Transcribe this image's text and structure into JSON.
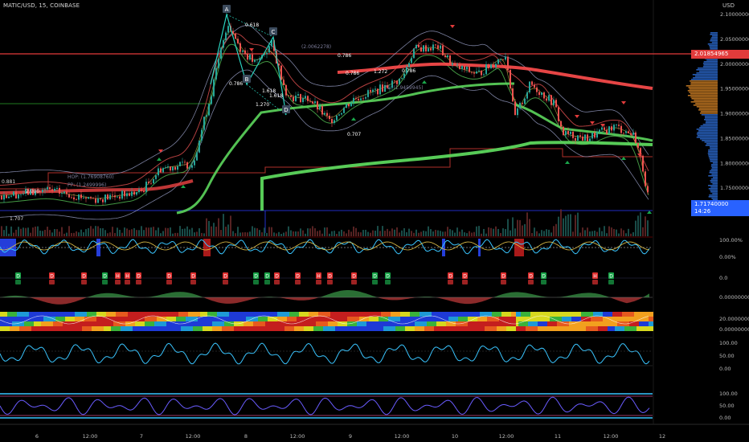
{
  "header": {
    "symbol": "MATIC/USD, 15, COINBASE",
    "currency": "USD"
  },
  "tags": {
    "hline_price": "2.01854965",
    "last_price": "1.71740000",
    "countdown": "14:26",
    "osc_pct": "100.00%"
  },
  "price_axis": [
    "2.10000000",
    "2.05000000",
    "2.00000000",
    "1.95000000",
    "1.90000000",
    "1.85000000",
    "1.80000000",
    "1.75000000",
    "1.70000000"
  ],
  "pane_axes": {
    "p2": [
      "100.00%",
      "0.00%"
    ],
    "p3": [
      "0.0"
    ],
    "p4": [
      "0.00000000"
    ],
    "p5": [
      "20.00000000",
      "0.00000000"
    ],
    "p6": [
      "100.00",
      "50.00",
      "0.00"
    ],
    "p7": [
      "100.00",
      "50.00",
      "0.00"
    ]
  },
  "time_axis": [
    "6",
    "12:00",
    "7",
    "12:00",
    "8",
    "12:00",
    "9",
    "12:00",
    "10",
    "12:00",
    "11",
    "12:00",
    "12"
  ],
  "pattern": {
    "points": [
      "A",
      "B",
      "C",
      "D"
    ],
    "fib": [
      "0.618",
      "0.786",
      "1.618",
      "1.618",
      "1.270",
      "0.786",
      "1.272",
      "0.786",
      "0.707",
      "0.786"
    ]
  },
  "level_labels": [
    "HOP: (1.76908760)",
    "PP: (1.2499996)",
    "T1: (1.9459945)",
    "(2.0062278)",
    "0.881",
    "2.000",
    "1.707"
  ],
  "colors": {
    "bg": "#000000",
    "bull": "#26a69a",
    "bear": "#ef5350",
    "hline": "#e23b3b",
    "last": "#2962ff",
    "ema_green": "#5cd65c",
    "ema_red": "#ff4d4d",
    "osc_cyan": "#39c5ff",
    "band": "#9aa0c8"
  },
  "signals": {
    "buy_char": "B",
    "sell_char": "S",
    "d_char": "D",
    "h_char": "H"
  }
}
